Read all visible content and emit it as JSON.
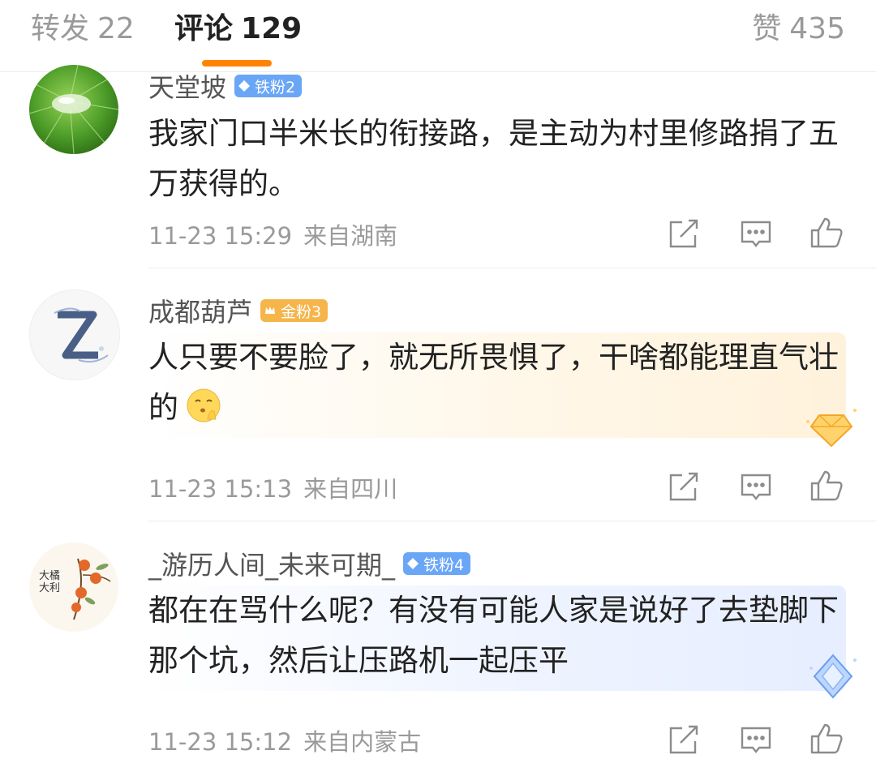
{
  "tabs": {
    "reposts": {
      "label": "转发",
      "count": "22"
    },
    "comments": {
      "label": "评论",
      "count": "129"
    },
    "likes": {
      "label": "赞",
      "count": "435"
    }
  },
  "colors": {
    "accent": "#ff8200",
    "iron_badge": "#6aa6f6",
    "gold_badge": "#f6b54a",
    "muted_text": "#9a9a9a"
  },
  "comments": [
    {
      "username": "天堂坡",
      "badge": "铁粉2",
      "badge_type": "iron",
      "content": "我家门口半米长的衔接路，是主动为村里修路捐了五万获得的。",
      "time": "11-23 15:29",
      "location": "来自湖南",
      "avatar_icon": "leaf-avatar"
    },
    {
      "username": "成都葫芦",
      "badge": "金粉3",
      "badge_type": "gold",
      "content": "人只要不要脸了，就无所畏惧了，干啥都能理直气壮的",
      "emoji": "shush-emoji",
      "time": "11-23 15:13",
      "location": "来自四川",
      "avatar_icon": "letter-z-avatar"
    },
    {
      "username": "_游历人间_未来可期_",
      "badge": "铁粉4",
      "badge_type": "iron",
      "content": "都在在骂什么呢？有没有可能人家是说好了去垫脚下那个坑，然后让压路机一起压平",
      "time": "11-23 15:12",
      "location": "来自内蒙古",
      "avatar_icon": "persimmon-avatar",
      "avatar_text": "大橘大利"
    }
  ],
  "action_icons": [
    "share-icon",
    "comment-icon",
    "like-icon"
  ]
}
